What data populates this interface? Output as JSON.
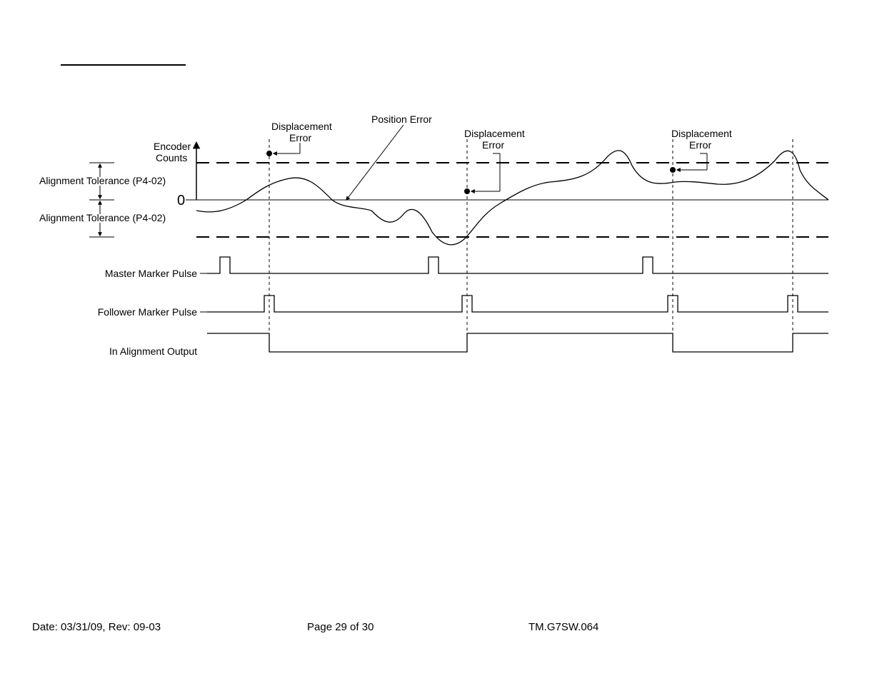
{
  "labels": {
    "encoder_counts_l1": "Encoder",
    "encoder_counts_l2": "Counts",
    "zero": "0",
    "align_tol_upper": "Alignment Tolerance (P4-02)",
    "align_tol_lower": "Alignment Tolerance (P4-02)",
    "position_error": "Position Error",
    "disp_err1_l1": "Displacement",
    "disp_err1_l2": "Error",
    "disp_err2_l1": "Displacement",
    "disp_err2_l2": "Error",
    "disp_err3_l1": "Displacement",
    "disp_err3_l2": "Error",
    "master_marker": "Master Marker Pulse",
    "follower_marker": "Follower Marker Pulse",
    "in_alignment": "In Alignment Output"
  },
  "footer": {
    "date": "Date: 03/31/09, Rev: 09-03",
    "page": "Page 29 of 30",
    "doc": "TM.G7SW.064"
  }
}
